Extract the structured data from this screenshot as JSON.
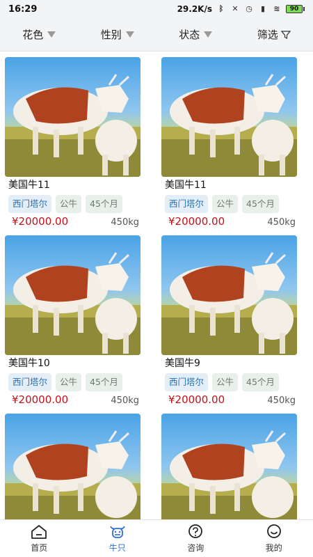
{
  "status_bar": {
    "time": "16:29",
    "net_speed": "29.2K/s",
    "battery": "90"
  },
  "filters": [
    {
      "label": "花色",
      "icon": "triangle-down-icon"
    },
    {
      "label": "性别",
      "icon": "triangle-down-icon"
    },
    {
      "label": "状态",
      "icon": "triangle-down-icon"
    },
    {
      "label": "筛选",
      "icon": "filter-icon"
    }
  ],
  "cards": [
    {
      "name": "美国牛11",
      "breed": "西门塔尔",
      "sex": "公牛",
      "age": "45个月",
      "price": "¥20000.00",
      "weight": "450kg"
    },
    {
      "name": "美国牛11",
      "breed": "西门塔尔",
      "sex": "公牛",
      "age": "45个月",
      "price": "¥20000.00",
      "weight": "450kg"
    },
    {
      "name": "美国牛10",
      "breed": "西门塔尔",
      "sex": "公牛",
      "age": "45个月",
      "price": "¥20000.00",
      "weight": "450kg"
    },
    {
      "name": "美国牛9",
      "breed": "西门塔尔",
      "sex": "公牛",
      "age": "45个月",
      "price": "¥20000.00",
      "weight": "450kg"
    },
    {
      "name": "",
      "breed": "",
      "sex": "",
      "age": "",
      "price": "",
      "weight": ""
    },
    {
      "name": "",
      "breed": "",
      "sex": "",
      "age": "",
      "price": "",
      "weight": ""
    }
  ],
  "tabs": [
    {
      "label": "首页",
      "icon": "home-icon",
      "active": false
    },
    {
      "label": "牛只",
      "icon": "cow-icon",
      "active": true
    },
    {
      "label": "咨询",
      "icon": "question-icon",
      "active": false
    },
    {
      "label": "我的",
      "icon": "smile-icon",
      "active": false
    }
  ],
  "colors": {
    "accent": "#2f6fd1",
    "price": "#c0111a",
    "breed_tag_text": "#2a6fb0"
  }
}
